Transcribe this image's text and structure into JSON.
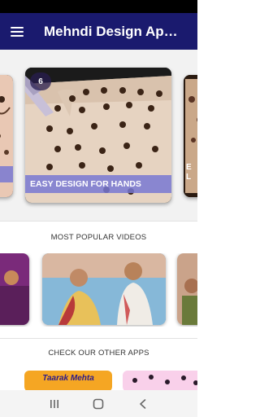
{
  "app": {
    "title": "Mehndi Design App ..."
  },
  "carousel": {
    "left_card": {
      "caption": ""
    },
    "center_card": {
      "badge": "6",
      "caption": "EASY DESIGN FOR HANDS"
    },
    "right_card": {
      "caption": "E\nL"
    }
  },
  "popular": {
    "title": "MOST POPULAR VIDEOS"
  },
  "other_apps": {
    "title": "CHECK OUR OTHER APPS",
    "app1_label": "Taarak Mehta"
  },
  "icons": {
    "menu": "hamburger-menu-icon",
    "nav_recents": "recents-icon",
    "nav_home": "home-icon",
    "nav_back": "back-icon"
  },
  "colors": {
    "appbar": "#1a1a6e",
    "caption_bg": "#7878d2",
    "accent_orange": "#f5a623"
  }
}
